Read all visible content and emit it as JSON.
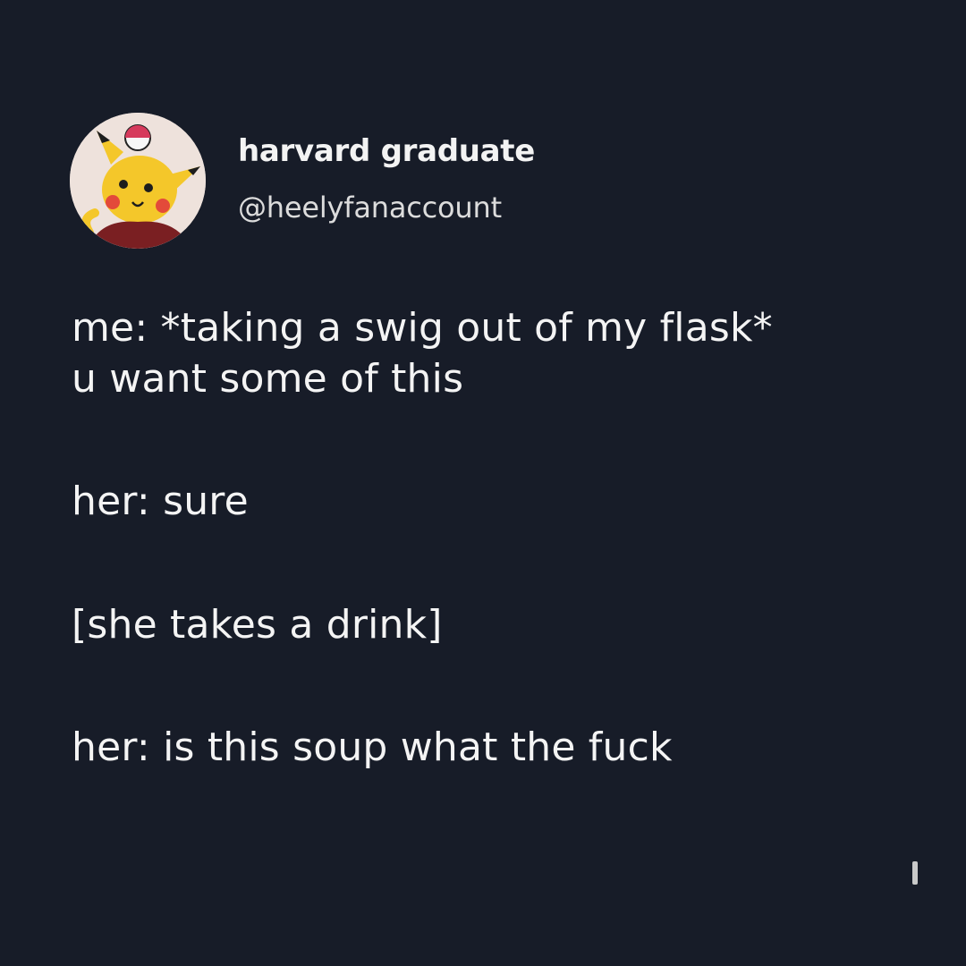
{
  "tweet": {
    "display_name": "harvard graduate",
    "handle": "@heelyfanaccount",
    "lines": [
      "me: *taking a swig out of my flask*",
      "u want some of this",
      "her: sure",
      "[she takes a drink]",
      "her: is this soup what the fuck"
    ]
  },
  "avatar": {
    "icon": "pikachu-avatar-icon"
  }
}
